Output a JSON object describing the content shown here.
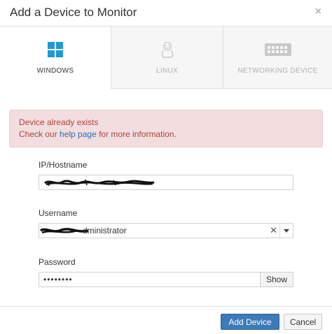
{
  "dialog": {
    "title": "Add a Device to Monitor",
    "close_glyph": "×"
  },
  "tabs": [
    {
      "label": "WINDOWS",
      "icon": "windows-icon",
      "active": true
    },
    {
      "label": "LINUX",
      "icon": "linux-icon",
      "active": false
    },
    {
      "label": "NETWORKING DEVICE",
      "icon": "network-device-icon",
      "active": false
    }
  ],
  "alert": {
    "line1": "Device already exists",
    "line2_prefix": "Check our ",
    "link_text": "help page",
    "line2_suffix": " for more information."
  },
  "form": {
    "ip_label": "IP/Hostname",
    "ip_value": "",
    "username_label": "Username",
    "username_value_visible": "dministrator",
    "password_label": "Password",
    "password_value": "••••••••",
    "show_label": "Show",
    "clear_glyph": "✕"
  },
  "footer": {
    "add_label": "Add Device",
    "cancel_label": "Cancel"
  },
  "colors": {
    "primary": "#3d7ab8",
    "alert_bg": "#f2dede",
    "alert_text": "#a94442",
    "link": "#2a6fb0"
  }
}
